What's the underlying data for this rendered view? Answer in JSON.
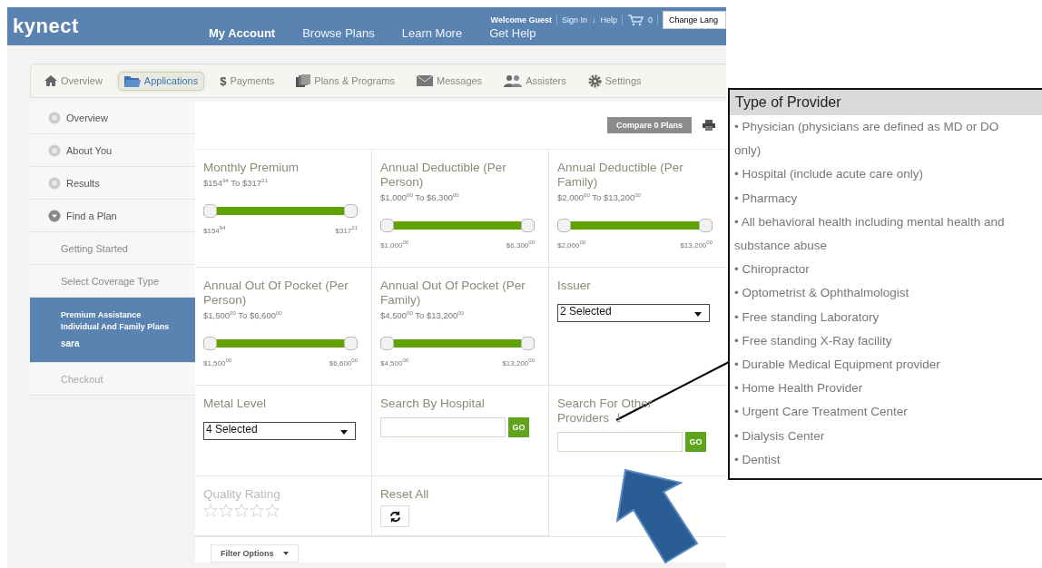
{
  "header": {
    "logo": "kynect",
    "nav": [
      {
        "label": "My Account",
        "selected": true
      },
      {
        "label": "Browse Plans",
        "selected": false
      },
      {
        "label": "Learn More",
        "selected": false
      },
      {
        "label": "Get Help",
        "selected": false
      }
    ],
    "welcome": "Welcome Guest",
    "links": [
      "Sign In",
      "↓",
      "Help"
    ],
    "cart_count": "0",
    "language_button": "Change Lang"
  },
  "tabs": [
    {
      "label": "Overview",
      "selected": false
    },
    {
      "label": "Applications",
      "selected": true
    },
    {
      "label": "Payments",
      "symbol": "$",
      "selected": false
    },
    {
      "label": "Plans & Programs",
      "selected": false
    },
    {
      "label": "Messages",
      "selected": false
    },
    {
      "label": "Assisters",
      "selected": false
    },
    {
      "label": "Settings",
      "selected": false
    }
  ],
  "sidebar": {
    "items": [
      {
        "label": "Overview",
        "expanded": false
      },
      {
        "label": "About You",
        "expanded": false
      },
      {
        "label": "Results",
        "expanded": false
      },
      {
        "label": "Find a Plan",
        "expanded": true,
        "children": [
          {
            "label": "Getting Started",
            "selected": false,
            "disabled": false
          },
          {
            "label": "Select Coverage Type",
            "selected": false,
            "disabled": false
          },
          {
            "label": "Premium Assistance Individual And Family Plans",
            "sublabel": "sara",
            "selected": true,
            "disabled": false
          },
          {
            "label": "Checkout",
            "selected": false,
            "disabled": true
          }
        ]
      }
    ]
  },
  "compare_button": "Compare 0 Plans",
  "filters": [
    {
      "kind": "slider",
      "label": "Monthly Premium",
      "range": "$154$^{94}$ To $317$^{21}$",
      "min": "$154$^{94}$",
      "max": "$317$^{21}$",
      "level": 1
    },
    {
      "kind": "slider",
      "label": "Annual Deductible (Per Person)",
      "range": "$1,000$^{00}$ To $6,300$^{00}$",
      "min": "$1,000$^{00}$",
      "max": "$6,300$^{00}$",
      "level": 1
    },
    {
      "kind": "slider",
      "label": "Annual Deductible (Per Family)",
      "range": "$2,000$^{00}$ To $13,200$^{00}$",
      "min": "$2,000$^{00}$",
      "max": "$13,200$^{00}$",
      "level": 1
    },
    {
      "kind": "slider",
      "label": "Annual Out Of Pocket (Per Person)",
      "range": "$1,500$^{00}$ To $6,600$^{00}$",
      "min": "$1,500$^{00}$",
      "max": "$6,600$^{00}$",
      "level": 1
    },
    {
      "kind": "slider",
      "label": "Annual Out Of Pocket (Per Family)",
      "range": "$4,500$^{00}$ To $13,200$^{00}$",
      "min": "$4,500$^{00}$",
      "max": "$13,200$^{00}$",
      "level": 1
    },
    {
      "kind": "select",
      "label": "Issuer",
      "value": "2 Selected"
    },
    {
      "kind": "select",
      "label": "Metal Level",
      "value": "4 Selected"
    },
    {
      "kind": "search",
      "label": "Search By Hospital",
      "button": "GO"
    },
    {
      "kind": "search",
      "label": "Search For Other Providers",
      "button": "GO",
      "info": true
    },
    {
      "kind": "rating",
      "label": "Quality Rating",
      "stars": 0,
      "disabled": true
    },
    {
      "kind": "reset",
      "label": "Reset All"
    }
  ],
  "filter_options": "Filter Options",
  "callout": {
    "title": "Type of Provider",
    "items": [
      "• Physician (physicians are defined as MD or DO only)",
      "• Hospital (include acute care only)",
      "• Pharmacy",
      "• All behavioral health including mental health and substance abuse",
      "• Chiropractor",
      "• Optometrist & Ophthalmologist",
      "• Free standing Laboratory",
      "• Free standing X-Ray facility",
      "• Durable Medical Equipment provider",
      "• Home Health Provider",
      "• Urgent Care Treatment Center",
      "• Dialysis Center",
      "• Dentist"
    ]
  }
}
